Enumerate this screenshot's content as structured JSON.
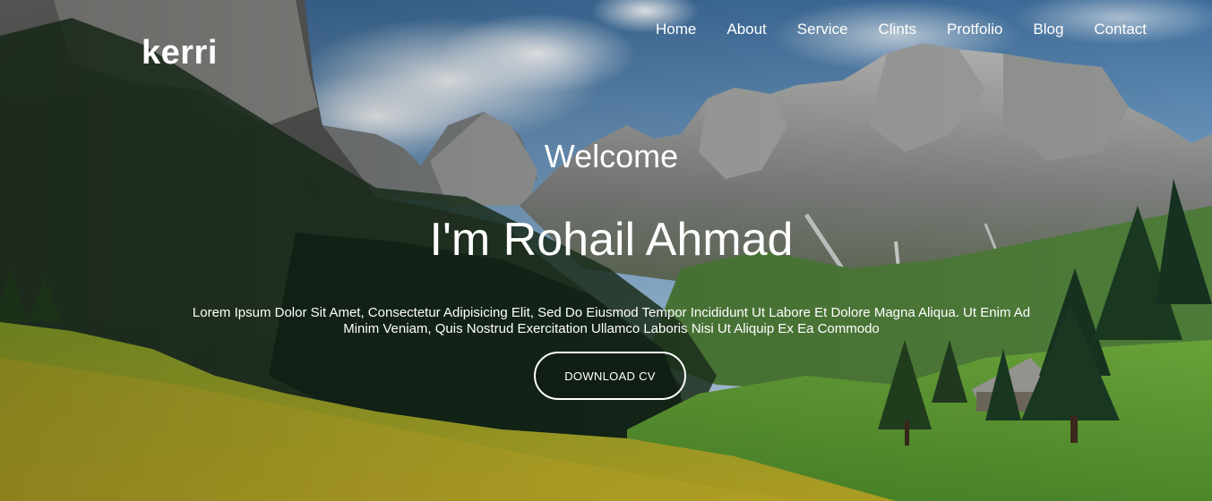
{
  "header": {
    "brand": "kerri",
    "nav": [
      "Home",
      "About",
      "Service",
      "Clints",
      "Protfolio",
      "Blog",
      "Contact"
    ]
  },
  "hero": {
    "greeting": "Welcome",
    "headline": "I'm Rohail Ahmad",
    "description": "Lorem Ipsum Dolor Sit Amet, Consectetur Adipisicing Elit, Sed Do Eiusmod Tempor Incididunt Ut Labore Et Dolore Magna Aliqua. Ut Enim Ad Minim Veniam, Quis Nostrud Exercitation Ullamco Laboris Nisi Ut Aliquip Ex Ea Commodo",
    "cta_label": "DOWNLOAD CV",
    "background_image": "mountain-valley-landscape"
  },
  "colors": {
    "text": "#ffffff",
    "sky": "#6f9cc4",
    "rock": "#8a8c8e",
    "forest": "#1f3a22",
    "meadow": "#7fb33a"
  }
}
